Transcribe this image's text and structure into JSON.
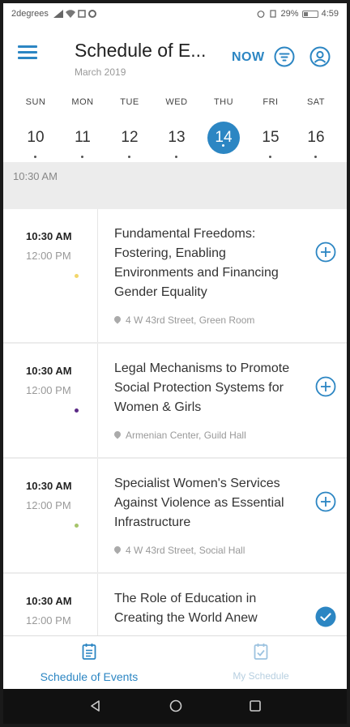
{
  "status": {
    "carrier": "2degrees",
    "battery": "29%",
    "time": "4:59"
  },
  "header": {
    "title": "Schedule of E...",
    "subtitle": "March 2019",
    "now_label": "NOW",
    "menu_icon": "hamburger-icon",
    "filter_icon": "filter-icon",
    "profile_icon": "profile-icon"
  },
  "colors": {
    "accent": "#2c86c3",
    "yellow_dot": "#f2d66b",
    "purple_dot": "#5b2a86",
    "green_dot": "#a6c46a"
  },
  "week": {
    "days": [
      {
        "name": "SUN",
        "num": "10",
        "active": false
      },
      {
        "name": "MON",
        "num": "11",
        "active": false
      },
      {
        "name": "TUE",
        "num": "12",
        "active": false
      },
      {
        "name": "WED",
        "num": "13",
        "active": false
      },
      {
        "name": "THU",
        "num": "14",
        "active": true
      },
      {
        "name": "FRI",
        "num": "15",
        "active": false
      },
      {
        "name": "SAT",
        "num": "16",
        "active": false
      }
    ]
  },
  "section": {
    "time_header": "10:30 AM"
  },
  "events": [
    {
      "start": "10:30 AM",
      "end": "12:00 PM",
      "title": "Fundamental Freedoms: Fostering, Enabling Environments and Financing Gender Equality",
      "location": "4 W 43rd Street, Green Room",
      "dot_color": "#f2d66b",
      "added": false
    },
    {
      "start": "10:30 AM",
      "end": "12:00 PM",
      "title": "Legal Mechanisms to Promote Social Protection Systems for Women & Girls",
      "location": "Armenian Center, Guild Hall",
      "dot_color": "#5b2a86",
      "added": false
    },
    {
      "start": "10:30 AM",
      "end": "12:00 PM",
      "title": "Specialist Women's Services Against Violence as Essential Infrastructure",
      "location": "4 W 43rd Street, Social Hall",
      "dot_color": "#a6c46a",
      "added": false
    },
    {
      "start": "10:30 AM",
      "end": "12:00 PM",
      "title": "The Role of Education in Creating the World Anew",
      "location": "",
      "dot_color": "",
      "added": true
    }
  ],
  "bottom_nav": {
    "schedule_label": "Schedule of Events",
    "my_schedule_label": "My Schedule"
  }
}
